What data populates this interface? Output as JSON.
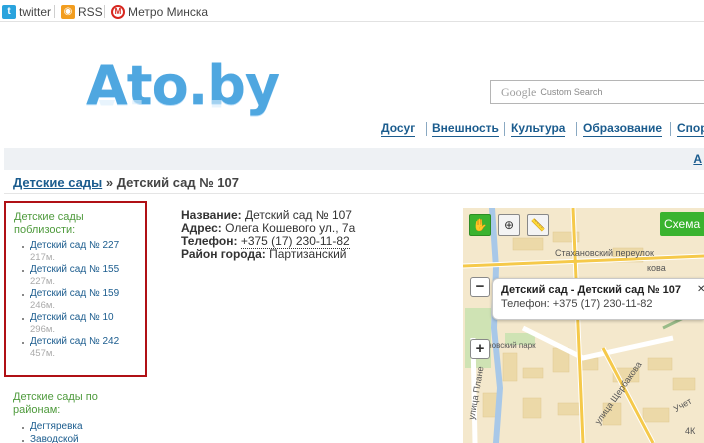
{
  "topbar": {
    "links": [
      {
        "label": "twitter",
        "icon": "twitter-icon",
        "color": "#2aa3dd"
      },
      {
        "label": "RSS",
        "icon": "rss-icon",
        "color": "#f29d1f"
      },
      {
        "label": "Метро Минска",
        "icon": "metro-icon",
        "color": "#d7261e"
      }
    ]
  },
  "header": {
    "logo": "Ato.by",
    "search_brand": "Google",
    "search_placeholder": "Custom Search",
    "nav": [
      "Досуг",
      "Внешность",
      "Культура",
      "Образование",
      "Спор"
    ],
    "strip_link": "А"
  },
  "breadcrumb": {
    "parent": "Детские сады",
    "separator": "»",
    "current": "Детский сад № 107"
  },
  "sidebar": {
    "nearby_title": "Детские сады поблизости:",
    "nearby": [
      {
        "name": "Детский сад № 227",
        "distance": "217м."
      },
      {
        "name": "Детский сад № 155",
        "distance": "227м."
      },
      {
        "name": "Детский сад № 159",
        "distance": "246м."
      },
      {
        "name": "Детский сад № 10",
        "distance": "296м."
      },
      {
        "name": "Детский сад № 242",
        "distance": "457м."
      }
    ],
    "districts_title": "Детские сады по районам:",
    "districts": [
      "Дегтяревка",
      "Заводской"
    ]
  },
  "details": {
    "name_label": "Название:",
    "name_value": "Детский сад № 107",
    "address_label": "Адрес:",
    "address_value": "Олега Кошевого ул., 7а",
    "phone_label": "Телефон:",
    "phone_value": "+375 (17) 230-11-82",
    "district_label": "Район города:",
    "district_value": "Партизанский"
  },
  "map": {
    "schema_button": "Схема",
    "zoom_out": "−",
    "zoom_in": "+",
    "balloon_title": "Детский сад - Детский сад № 107",
    "balloon_phone": "Телефон: +375 (17) 230-11-82",
    "close": "✕",
    "labels": {
      "stakhanov": "Стахановский переулок",
      "kova": "кова",
      "park": "Ароновский парк",
      "plan": "улица Плане",
      "shcherb": "улица Щербакова",
      "uch": "Учет",
      "kk": "4К"
    },
    "accent_green": "#3ab32f"
  }
}
